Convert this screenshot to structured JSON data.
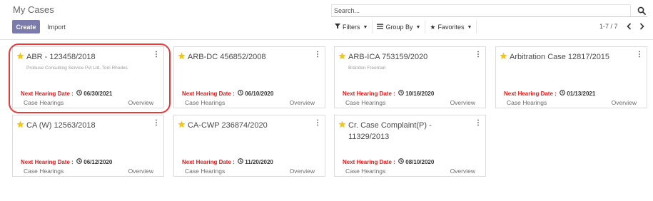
{
  "title": "My Cases",
  "buttons": {
    "create": "Create",
    "import": "Import"
  },
  "search": {
    "placeholder": "Search..."
  },
  "filters": {
    "filters_label": "Filters",
    "group_by_label": "Group By",
    "favorites_label": "Favorites"
  },
  "pager": {
    "text": "1-7 / 7"
  },
  "hearing_label": "Next Hearing Date :",
  "links": {
    "hearings": "Case Hearings",
    "overview": "Overview"
  },
  "colors": {
    "accent": "#7c7bad",
    "star": "#f3c614",
    "hearing_label": "#e01b1b",
    "highlight_ring": "#e53b3b"
  },
  "icons": [
    "search-icon",
    "filter-icon",
    "group-by-icon",
    "star-icon",
    "chevron-left-icon",
    "chevron-right-icon",
    "kebab-menu-icon",
    "clock-icon"
  ],
  "cases": [
    {
      "name": "ABR - 123458/2018",
      "client": "Probuse Consulting Service Pvt Ltd, Toni Rhodes",
      "date": "06/30/2021"
    },
    {
      "name": "ARB-DC 456852/2008",
      "client": "",
      "date": "06/10/2020"
    },
    {
      "name": "ARB-ICA 753159/2020",
      "client": "Brandon Freeman",
      "date": "10/16/2020"
    },
    {
      "name": "Arbitration Case 12817/2015",
      "client": "",
      "date": "01/13/2021"
    },
    {
      "name": "CA (W) 12563/2018",
      "client": "",
      "date": "06/12/2020"
    },
    {
      "name": "CA-CWP 236874/2020",
      "client": "",
      "date": "11/20/2020"
    },
    {
      "name": "Cr. Case Complaint(P) - 11329/2013",
      "client": "",
      "date": "08/10/2020"
    }
  ]
}
